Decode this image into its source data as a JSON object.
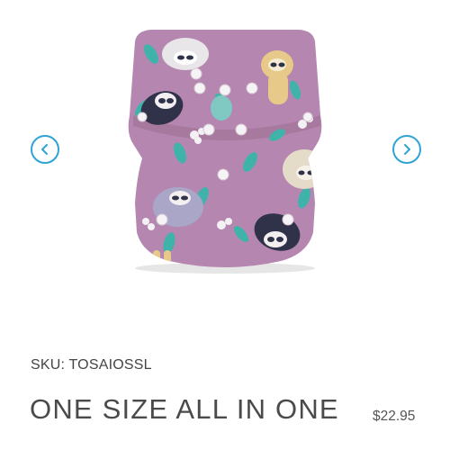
{
  "product": {
    "sku_text": "SKU: TOSAIOSSL",
    "title": "ONE SIZE ALL IN ONE",
    "price": "$22.95"
  },
  "carousel": {
    "prev_icon": "chevron-left-icon",
    "next_icon": "chevron-right-icon"
  },
  "colors": {
    "accent": "#2fa3d6",
    "diaper_base": "#b586b0",
    "leaf_teal": "#3fb3a9"
  }
}
